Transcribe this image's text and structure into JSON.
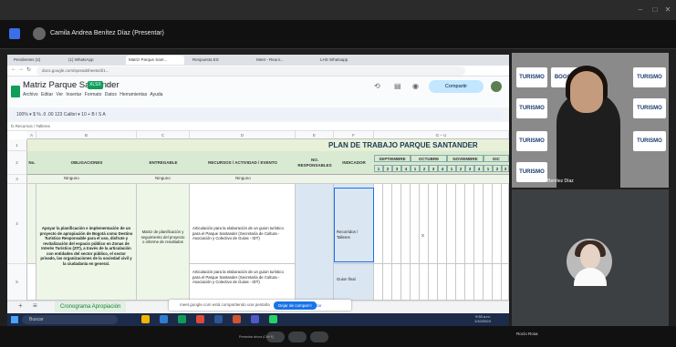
{
  "meet": {
    "presenter_label": "Camila Andrea Benítez Díaz (Presentar)"
  },
  "inner_browser": {
    "tabs": [
      "Pendientes (2)",
      "(1) WhatsApp",
      "Matriz Parque Sant...",
      "Respuesta ES",
      "Meet - Reuni...",
      "LHS Whatsapp"
    ],
    "address": "docs.google.com/spreadsheets/d/1..."
  },
  "sheets": {
    "title": "Matriz Parque Santander",
    "file_badge": "XLSX",
    "menus": "Archivo Editar Ver Insertar Formato Datos Herramientas Ayuda",
    "share_label": "Compartir",
    "toolbar_text": "100%  ▾  $  %  .0  .00  123  Calibri  ▾  10  +  B  I  S  A",
    "formula_bar": "fx  Recursos / Talleres",
    "plan_title": "PLAN DE TRABAJO PARQUE SANTANDER",
    "headers": {
      "no": "No.",
      "obligaciones": "OBLIGACIONES",
      "entregable": "ENTREGABLE",
      "recursos": "RECURSOS / ACTIVIDAD / EVENTO",
      "responsable": "NO. RESPONSABLES",
      "indicador": "INDICADOR"
    },
    "months": [
      "SEPTIEMBRE",
      "OCTUBRE",
      "NOVIEMBRE",
      "DIC"
    ],
    "filter": "Ninguno",
    "row1": {
      "obligacion": "Apoyar la planificación e implementación de un proyecto de apropiación de Bogotá como Destino Turístico Responsable para el uso, disfrute y revitalización del espacio público en Zonas de Interés Turístico (ZIT), a través de la articulación con entidades del sector público, el sector privado, las organizaciones de la sociedad civil y la ciudadanía en general.",
      "entregable": "Matriz de planificación y seguimiento del proyecto o informe de resultados",
      "recursos": "Articulación para la elaboración de un guion turístico para el Parque Santander (Secretaría de Cultura - Asociación y Colectivo de Guías - IDT)",
      "indicador": "Recorridos / Talleres"
    },
    "row2": {
      "recursos": "Articulación para la elaboración de un guion turístico para el Parque Santander (Secretaría de Cultura - Asociación y Colectivo de Guías - IDT)",
      "indicador": "Guion final"
    },
    "sheet_tab": "Cronograma Apropiación",
    "share_banner": "meet.google.com está compartiendo una pestaña",
    "stop_share": "Dejar de compartir",
    "hide": "Ocultar"
  },
  "taskbar": {
    "search": "Buscar",
    "clock_time": "9:53 a.m.",
    "clock_date": "1/10/2024"
  },
  "tiles": {
    "brand1": "TURISMO",
    "brand2": "BOGOTÁ",
    "participant1": "Camila Andrea Benítez Díaz",
    "participant2": "Rocío Rosa"
  },
  "meet_bottom": {
    "tip": "Presentar ahora (Ctrl+E)"
  }
}
